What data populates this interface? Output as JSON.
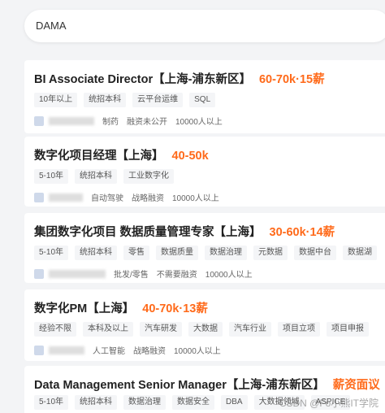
{
  "search": {
    "query": "DAMA"
  },
  "jobs": [
    {
      "title": "BI Associate Director【上海-浦东新区】",
      "salary": "60-70k·15薪",
      "tags": [
        "10年以上",
        "统招本科",
        "云平台运维",
        "SQL"
      ],
      "meta": [
        "制药",
        "融资未公开",
        "10000人以上"
      ]
    },
    {
      "title": "数字化项目经理【上海】",
      "salary": "40-50k",
      "tags": [
        "5-10年",
        "统招本科",
        "工业数字化"
      ],
      "meta": [
        "自动驾驶",
        "战略融资",
        "10000人以上"
      ]
    },
    {
      "title": "集团数字化项目 数据质量管理专家【上海】",
      "salary": "30-60k·14薪",
      "tags": [
        "5-10年",
        "统招本科",
        "零售",
        "数据质量",
        "数据治理",
        "元数据",
        "数据中台",
        "数据湖"
      ],
      "meta": [
        "批发/零售",
        "不需要融资",
        "10000人以上"
      ]
    },
    {
      "title": "数字化PM【上海】",
      "salary": "40-70k·13薪",
      "tags": [
        "经验不限",
        "本科及以上",
        "汽车研发",
        "大数据",
        "汽车行业",
        "项目立项",
        "项目申报"
      ],
      "meta": [
        "人工智能",
        "战略融资",
        "10000人以上"
      ]
    },
    {
      "title": "Data Management Senior Manager【上海-浦东新区】",
      "salary": "薪资面议",
      "tags": [
        "5-10年",
        "统招本科",
        "数据治理",
        "数据安全",
        "DBA",
        "大数据领域",
        "ASPICE"
      ],
      "meta": []
    }
  ],
  "watermark": "CSDN @Fo小熊IT学院"
}
